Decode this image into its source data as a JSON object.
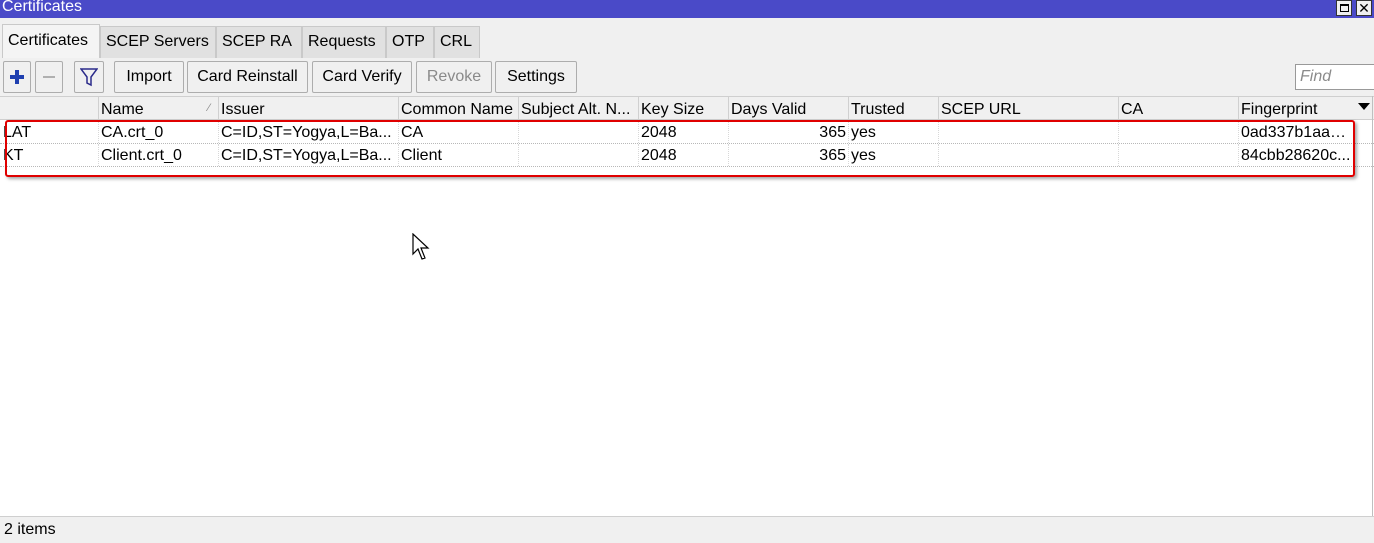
{
  "window": {
    "title": "Certificates"
  },
  "tabs": [
    "Certificates",
    "SCEP Servers",
    "SCEP RA",
    "Requests",
    "OTP",
    "CRL"
  ],
  "toolbar": {
    "import_label": "Import",
    "card_reinstall_label": "Card Reinstall",
    "card_verify_label": "Card Verify",
    "revoke_label": "Revoke",
    "settings_label": "Settings",
    "find_placeholder": "Find"
  },
  "table": {
    "columns": [
      "",
      "Name",
      "Issuer",
      "Common Name",
      "Subject Alt. N...",
      "Key Size",
      "Days Valid",
      "Trusted",
      "SCEP URL",
      "CA",
      "Fingerprint"
    ],
    "rows": [
      {
        "flags": "LAT",
        "name": "CA.crt_0",
        "issuer": "C=ID,ST=Yogya,L=Ba...",
        "common_name": "CA",
        "subject_alt": "",
        "key_size": "2048",
        "days_valid": "365",
        "trusted": "yes",
        "scep_url": "",
        "ca": "",
        "fingerprint": "0ad337b1aa2..."
      },
      {
        "flags": "KT",
        "name": "Client.crt_0",
        "issuer": "C=ID,ST=Yogya,L=Ba...",
        "common_name": "Client",
        "subject_alt": "",
        "key_size": "2048",
        "days_valid": "365",
        "trusted": "yes",
        "scep_url": "",
        "ca": "",
        "fingerprint": "84cbb28620c..."
      }
    ]
  },
  "status": {
    "item_count": "2 items"
  },
  "colors": {
    "titlebar": "#4a4ac8",
    "highlight": "#e00000",
    "add_icon": "#1f3fb0"
  }
}
